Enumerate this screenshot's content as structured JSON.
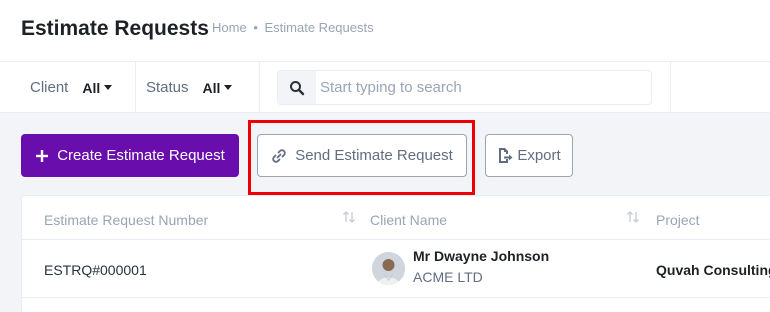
{
  "header": {
    "title": "Estimate Requests",
    "breadcrumb": {
      "home": "Home",
      "separator": "•",
      "current": "Estimate Requests"
    }
  },
  "filters": {
    "client": {
      "label": "Client",
      "value": "All"
    },
    "status": {
      "label": "Status",
      "value": "All"
    },
    "search": {
      "placeholder": "Start typing to search"
    }
  },
  "actions": {
    "create_label": "Create Estimate Request",
    "send_label": "Send Estimate Request",
    "export_label": "Export"
  },
  "table": {
    "columns": [
      "Estimate Request Number",
      "Client Name",
      "Project"
    ],
    "rows": [
      {
        "number": "ESTRQ#000001",
        "client_name": "Mr Dwayne Johnson",
        "client_company": "ACME LTD",
        "project": "Quvah Consulting"
      }
    ]
  },
  "colors": {
    "primary": "#6a0dad",
    "highlight": "#ee0000"
  }
}
